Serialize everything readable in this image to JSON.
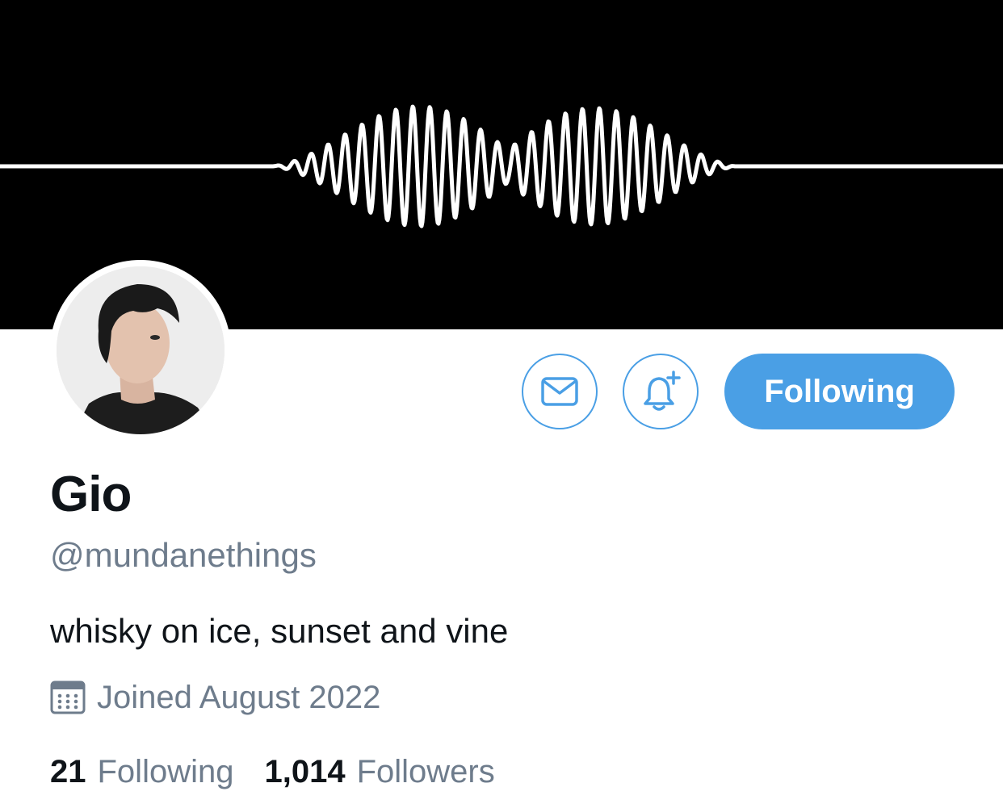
{
  "profile": {
    "name": "Gio",
    "handle": "@mundanethings",
    "bio": "whisky on ice, sunset and vine",
    "joined": "Joined August 2022"
  },
  "actions": {
    "follow_label": "Following"
  },
  "stats": {
    "following_count": "21",
    "following_label": "Following",
    "followers_count": "1,014",
    "followers_label": "Followers"
  },
  "icons": {
    "mail": "mail-icon",
    "bell": "bell-plus-icon",
    "calendar": "calendar-icon"
  },
  "colors": {
    "accent": "#4a9fe5",
    "banner": "#000000",
    "secondary_text": "#6e7c8c",
    "primary_text": "#0f1419"
  }
}
